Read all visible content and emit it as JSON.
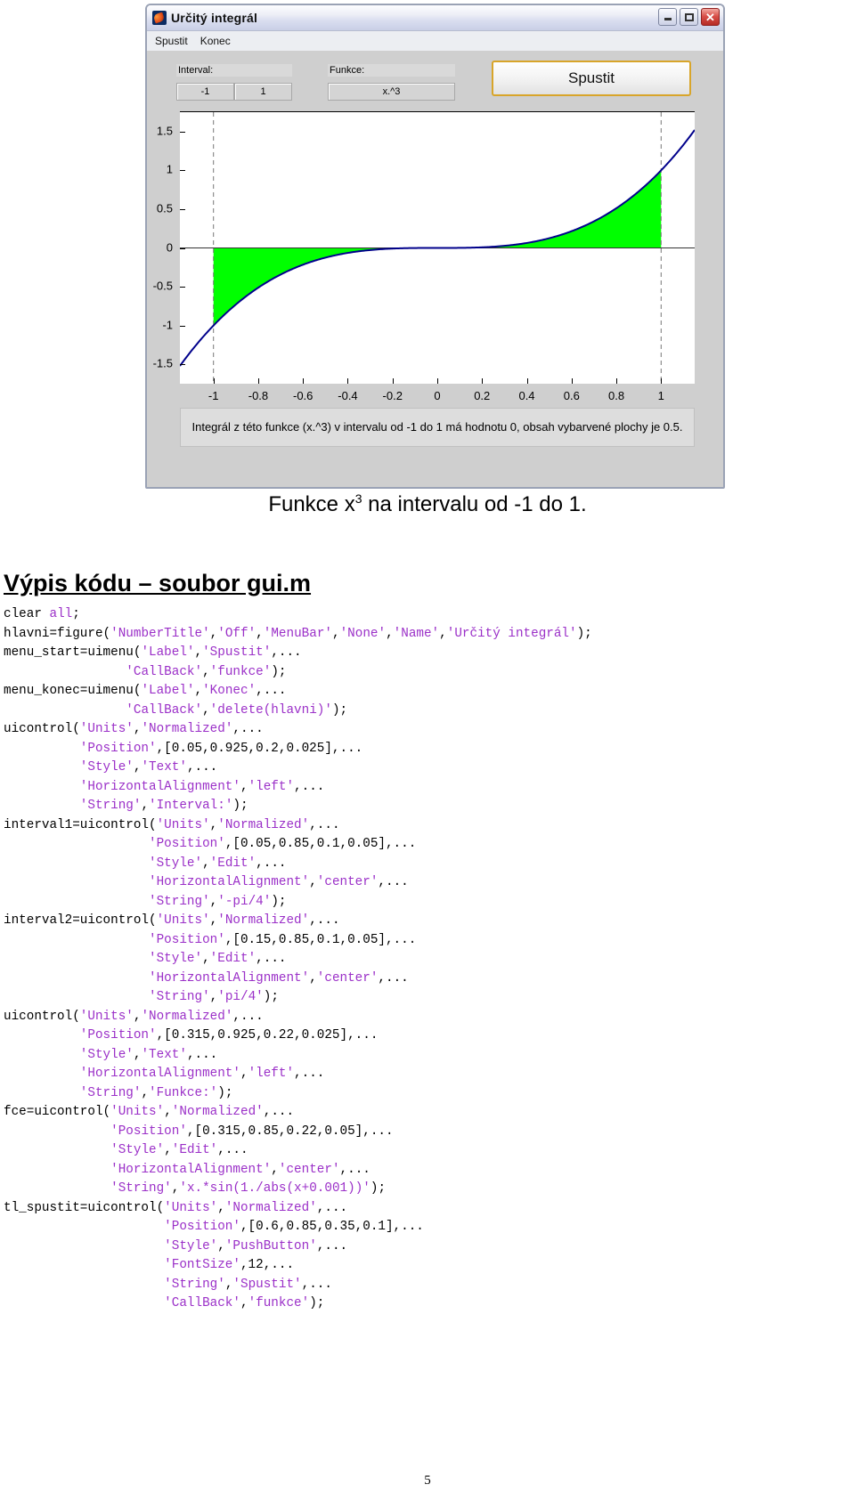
{
  "window": {
    "title": "Určitý integrál",
    "icon": "matlab-icon",
    "buttons": {
      "minimize": "_",
      "maximize": "□",
      "close": "✕"
    },
    "menu": [
      "Spustit",
      "Konec"
    ]
  },
  "controls": {
    "interval_label": "Interval:",
    "interval_from": "-1",
    "interval_to": "1",
    "funkce_label": "Funkce:",
    "funkce_value": "x.^3",
    "run_button": "Spustit"
  },
  "chart_data": {
    "type": "line",
    "title": "",
    "xlabel": "",
    "ylabel": "",
    "x_ticks": [
      "-1",
      "-0.8",
      "-0.6",
      "-0.4",
      "-0.2",
      "0",
      "0.2",
      "0.4",
      "0.6",
      "0.8",
      "1"
    ],
    "y_ticks": [
      "1.5",
      "1",
      "0.5",
      "0",
      "-0.5",
      "-1",
      "-1.5"
    ],
    "xlim": [
      -1.15,
      1.15
    ],
    "ylim": [
      -1.75,
      1.75
    ],
    "grid": false,
    "legend": "none",
    "series": [
      {
        "name": "x.^3",
        "color": "#00008b",
        "x": [
          -1.15,
          -1.1,
          -1.05,
          -1,
          -0.9,
          -0.8,
          -0.7,
          -0.6,
          -0.5,
          -0.4,
          -0.3,
          -0.2,
          -0.1,
          0,
          0.1,
          0.2,
          0.3,
          0.4,
          0.5,
          0.6,
          0.7,
          0.8,
          0.9,
          1,
          1.05,
          1.1,
          1.15
        ],
        "y": [
          -1.52,
          -1.331,
          -1.158,
          -1,
          -0.729,
          -0.512,
          -0.343,
          -0.216,
          -0.125,
          -0.064,
          -0.027,
          -0.008,
          -0.001,
          0,
          0.001,
          0.008,
          0.027,
          0.064,
          0.125,
          0.216,
          0.343,
          0.512,
          0.729,
          1,
          1.158,
          1.331,
          1.52
        ]
      }
    ],
    "fill": {
      "name": "vybarvená plocha",
      "color": "#00ff00",
      "from": -1,
      "to": 1
    },
    "markers": {
      "vertical_dashed_at": [
        -1,
        1
      ],
      "zero_line": 0
    }
  },
  "plot_caption": "Integrál z této funkce (x.^3) v intervalu od -1 do 1 má hodnotu 0, obsah vybarvené plochy je 0.5.",
  "figure_caption_pre": "Funkce x",
  "figure_caption_sup": "3",
  "figure_caption_post": " na intervalu od -1 do 1.",
  "code_heading": "Výpis kódu – soubor gui.m",
  "code_lines": [
    [
      {
        "t": "clear ",
        "c": "p"
      },
      {
        "t": "all",
        "c": "s"
      },
      {
        "t": ";",
        "c": "p"
      }
    ],
    [
      {
        "t": "hlavni=figure(",
        "c": "p"
      },
      {
        "t": "'NumberTitle'",
        "c": "s"
      },
      {
        "t": ",",
        "c": "p"
      },
      {
        "t": "'Off'",
        "c": "s"
      },
      {
        "t": ",",
        "c": "p"
      },
      {
        "t": "'MenuBar'",
        "c": "s"
      },
      {
        "t": ",",
        "c": "p"
      },
      {
        "t": "'None'",
        "c": "s"
      },
      {
        "t": ",",
        "c": "p"
      },
      {
        "t": "'Name'",
        "c": "s"
      },
      {
        "t": ",",
        "c": "p"
      },
      {
        "t": "'Určitý integrál'",
        "c": "s"
      },
      {
        "t": ");",
        "c": "p"
      }
    ],
    [
      {
        "t": "menu_start=uimenu(",
        "c": "p"
      },
      {
        "t": "'Label'",
        "c": "s"
      },
      {
        "t": ",",
        "c": "p"
      },
      {
        "t": "'Spustit'",
        "c": "s"
      },
      {
        "t": ",...",
        "c": "p"
      }
    ],
    [
      {
        "t": "                ",
        "c": "p"
      },
      {
        "t": "'CallBack'",
        "c": "s"
      },
      {
        "t": ",",
        "c": "p"
      },
      {
        "t": "'funkce'",
        "c": "s"
      },
      {
        "t": ");",
        "c": "p"
      }
    ],
    [
      {
        "t": "menu_konec=uimenu(",
        "c": "p"
      },
      {
        "t": "'Label'",
        "c": "s"
      },
      {
        "t": ",",
        "c": "p"
      },
      {
        "t": "'Konec'",
        "c": "s"
      },
      {
        "t": ",...",
        "c": "p"
      }
    ],
    [
      {
        "t": "                ",
        "c": "p"
      },
      {
        "t": "'CallBack'",
        "c": "s"
      },
      {
        "t": ",",
        "c": "p"
      },
      {
        "t": "'delete(hlavni)'",
        "c": "s"
      },
      {
        "t": ");",
        "c": "p"
      }
    ],
    [
      {
        "t": "uicontrol(",
        "c": "p"
      },
      {
        "t": "'Units'",
        "c": "s"
      },
      {
        "t": ",",
        "c": "p"
      },
      {
        "t": "'Normalized'",
        "c": "s"
      },
      {
        "t": ",...",
        "c": "p"
      }
    ],
    [
      {
        "t": "          ",
        "c": "p"
      },
      {
        "t": "'Position'",
        "c": "s"
      },
      {
        "t": ",[0.05,0.925,0.2,0.025],...",
        "c": "p"
      }
    ],
    [
      {
        "t": "          ",
        "c": "p"
      },
      {
        "t": "'Style'",
        "c": "s"
      },
      {
        "t": ",",
        "c": "p"
      },
      {
        "t": "'Text'",
        "c": "s"
      },
      {
        "t": ",...",
        "c": "p"
      }
    ],
    [
      {
        "t": "          ",
        "c": "p"
      },
      {
        "t": "'HorizontalAlignment'",
        "c": "s"
      },
      {
        "t": ",",
        "c": "p"
      },
      {
        "t": "'left'",
        "c": "s"
      },
      {
        "t": ",...",
        "c": "p"
      }
    ],
    [
      {
        "t": "          ",
        "c": "p"
      },
      {
        "t": "'String'",
        "c": "s"
      },
      {
        "t": ",",
        "c": "p"
      },
      {
        "t": "'Interval:'",
        "c": "s"
      },
      {
        "t": ");",
        "c": "p"
      }
    ],
    [
      {
        "t": "interval1=uicontrol(",
        "c": "p"
      },
      {
        "t": "'Units'",
        "c": "s"
      },
      {
        "t": ",",
        "c": "p"
      },
      {
        "t": "'Normalized'",
        "c": "s"
      },
      {
        "t": ",...",
        "c": "p"
      }
    ],
    [
      {
        "t": "                   ",
        "c": "p"
      },
      {
        "t": "'Position'",
        "c": "s"
      },
      {
        "t": ",[0.05,0.85,0.1,0.05],...",
        "c": "p"
      }
    ],
    [
      {
        "t": "                   ",
        "c": "p"
      },
      {
        "t": "'Style'",
        "c": "s"
      },
      {
        "t": ",",
        "c": "p"
      },
      {
        "t": "'Edit'",
        "c": "s"
      },
      {
        "t": ",...",
        "c": "p"
      }
    ],
    [
      {
        "t": "                   ",
        "c": "p"
      },
      {
        "t": "'HorizontalAlignment'",
        "c": "s"
      },
      {
        "t": ",",
        "c": "p"
      },
      {
        "t": "'center'",
        "c": "s"
      },
      {
        "t": ",...",
        "c": "p"
      }
    ],
    [
      {
        "t": "                   ",
        "c": "p"
      },
      {
        "t": "'String'",
        "c": "s"
      },
      {
        "t": ",",
        "c": "p"
      },
      {
        "t": "'-pi/4'",
        "c": "s"
      },
      {
        "t": ");",
        "c": "p"
      }
    ],
    [
      {
        "t": "interval2=uicontrol(",
        "c": "p"
      },
      {
        "t": "'Units'",
        "c": "s"
      },
      {
        "t": ",",
        "c": "p"
      },
      {
        "t": "'Normalized'",
        "c": "s"
      },
      {
        "t": ",...",
        "c": "p"
      }
    ],
    [
      {
        "t": "                   ",
        "c": "p"
      },
      {
        "t": "'Position'",
        "c": "s"
      },
      {
        "t": ",[0.15,0.85,0.1,0.05],...",
        "c": "p"
      }
    ],
    [
      {
        "t": "                   ",
        "c": "p"
      },
      {
        "t": "'Style'",
        "c": "s"
      },
      {
        "t": ",",
        "c": "p"
      },
      {
        "t": "'Edit'",
        "c": "s"
      },
      {
        "t": ",...",
        "c": "p"
      }
    ],
    [
      {
        "t": "                   ",
        "c": "p"
      },
      {
        "t": "'HorizontalAlignment'",
        "c": "s"
      },
      {
        "t": ",",
        "c": "p"
      },
      {
        "t": "'center'",
        "c": "s"
      },
      {
        "t": ",...",
        "c": "p"
      }
    ],
    [
      {
        "t": "                   ",
        "c": "p"
      },
      {
        "t": "'String'",
        "c": "s"
      },
      {
        "t": ",",
        "c": "p"
      },
      {
        "t": "'pi/4'",
        "c": "s"
      },
      {
        "t": ");",
        "c": "p"
      }
    ],
    [
      {
        "t": "uicontrol(",
        "c": "p"
      },
      {
        "t": "'Units'",
        "c": "s"
      },
      {
        "t": ",",
        "c": "p"
      },
      {
        "t": "'Normalized'",
        "c": "s"
      },
      {
        "t": ",...",
        "c": "p"
      }
    ],
    [
      {
        "t": "          ",
        "c": "p"
      },
      {
        "t": "'Position'",
        "c": "s"
      },
      {
        "t": ",[0.315,0.925,0.22,0.025],...",
        "c": "p"
      }
    ],
    [
      {
        "t": "          ",
        "c": "p"
      },
      {
        "t": "'Style'",
        "c": "s"
      },
      {
        "t": ",",
        "c": "p"
      },
      {
        "t": "'Text'",
        "c": "s"
      },
      {
        "t": ",...",
        "c": "p"
      }
    ],
    [
      {
        "t": "          ",
        "c": "p"
      },
      {
        "t": "'HorizontalAlignment'",
        "c": "s"
      },
      {
        "t": ",",
        "c": "p"
      },
      {
        "t": "'left'",
        "c": "s"
      },
      {
        "t": ",...",
        "c": "p"
      }
    ],
    [
      {
        "t": "          ",
        "c": "p"
      },
      {
        "t": "'String'",
        "c": "s"
      },
      {
        "t": ",",
        "c": "p"
      },
      {
        "t": "'Funkce:'",
        "c": "s"
      },
      {
        "t": ");",
        "c": "p"
      }
    ],
    [
      {
        "t": "fce=uicontrol(",
        "c": "p"
      },
      {
        "t": "'Units'",
        "c": "s"
      },
      {
        "t": ",",
        "c": "p"
      },
      {
        "t": "'Normalized'",
        "c": "s"
      },
      {
        "t": ",...",
        "c": "p"
      }
    ],
    [
      {
        "t": "              ",
        "c": "p"
      },
      {
        "t": "'Position'",
        "c": "s"
      },
      {
        "t": ",[0.315,0.85,0.22,0.05],...",
        "c": "p"
      }
    ],
    [
      {
        "t": "              ",
        "c": "p"
      },
      {
        "t": "'Style'",
        "c": "s"
      },
      {
        "t": ",",
        "c": "p"
      },
      {
        "t": "'Edit'",
        "c": "s"
      },
      {
        "t": ",...",
        "c": "p"
      }
    ],
    [
      {
        "t": "              ",
        "c": "p"
      },
      {
        "t": "'HorizontalAlignment'",
        "c": "s"
      },
      {
        "t": ",",
        "c": "p"
      },
      {
        "t": "'center'",
        "c": "s"
      },
      {
        "t": ",...",
        "c": "p"
      }
    ],
    [
      {
        "t": "              ",
        "c": "p"
      },
      {
        "t": "'String'",
        "c": "s"
      },
      {
        "t": ",",
        "c": "p"
      },
      {
        "t": "'x.*sin(1./abs(x+0.001))'",
        "c": "s"
      },
      {
        "t": ");",
        "c": "p"
      }
    ],
    [
      {
        "t": "tl_spustit=uicontrol(",
        "c": "p"
      },
      {
        "t": "'Units'",
        "c": "s"
      },
      {
        "t": ",",
        "c": "p"
      },
      {
        "t": "'Normalized'",
        "c": "s"
      },
      {
        "t": ",...",
        "c": "p"
      }
    ],
    [
      {
        "t": "                     ",
        "c": "p"
      },
      {
        "t": "'Position'",
        "c": "s"
      },
      {
        "t": ",[0.6,0.85,0.35,0.1],...",
        "c": "p"
      }
    ],
    [
      {
        "t": "                     ",
        "c": "p"
      },
      {
        "t": "'Style'",
        "c": "s"
      },
      {
        "t": ",",
        "c": "p"
      },
      {
        "t": "'PushButton'",
        "c": "s"
      },
      {
        "t": ",...",
        "c": "p"
      }
    ],
    [
      {
        "t": "                     ",
        "c": "p"
      },
      {
        "t": "'FontSize'",
        "c": "s"
      },
      {
        "t": ",12,...",
        "c": "p"
      }
    ],
    [
      {
        "t": "                     ",
        "c": "p"
      },
      {
        "t": "'String'",
        "c": "s"
      },
      {
        "t": ",",
        "c": "p"
      },
      {
        "t": "'Spustit'",
        "c": "s"
      },
      {
        "t": ",...",
        "c": "p"
      }
    ],
    [
      {
        "t": "                     ",
        "c": "p"
      },
      {
        "t": "'CallBack'",
        "c": "s"
      },
      {
        "t": ",",
        "c": "p"
      },
      {
        "t": "'funkce'",
        "c": "s"
      },
      {
        "t": ");",
        "c": "p"
      }
    ]
  ],
  "page_number": "5"
}
